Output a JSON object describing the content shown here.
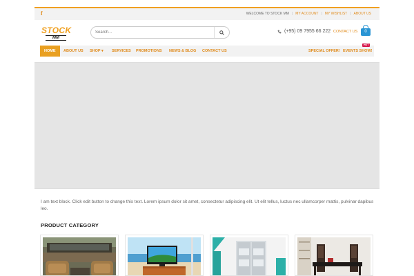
{
  "topbar": {
    "facebook_icon": "facebook-icon",
    "welcome": "WELCOME TO STOCK MM",
    "links": [
      "MY ACCOUNT",
      "MY WISHLIST",
      "ABOUT US"
    ],
    "separator": "|"
  },
  "header": {
    "logo_top": "STOCK",
    "logo_bottom": "MM",
    "search_placeholder": "Search...",
    "search_icon": "search-icon",
    "phone": "(+95) 09 7955 66 222",
    "separator": "|",
    "contact_link": "CONTACT US",
    "cart_count": "0"
  },
  "nav": {
    "items": [
      "HOME",
      "ABOUT US",
      "SHOP",
      "SERVICES",
      "PROMOTIONS",
      "NEWS & BLOG",
      "CONTACT US"
    ],
    "right_items": [
      "SPECIAL OFFER!",
      "EVENTS SHOW!"
    ],
    "hot_badge": "HOT",
    "shop_arrow": "▾"
  },
  "content": {
    "text_block": "I am text block. Click edit button to change this text. Lorem ipsum dolor sit amet, consectetur adipiscing elit. Ut elit tellus, luctus nec ullamcorper mattis, pulvinar dapibus leo.",
    "section_title": "PRODUCT CATEGORY"
  },
  "colors": {
    "accent": "#e9a021",
    "link": "#e08a1a",
    "cart": "#2a95d4",
    "hot": "#d6174b"
  }
}
